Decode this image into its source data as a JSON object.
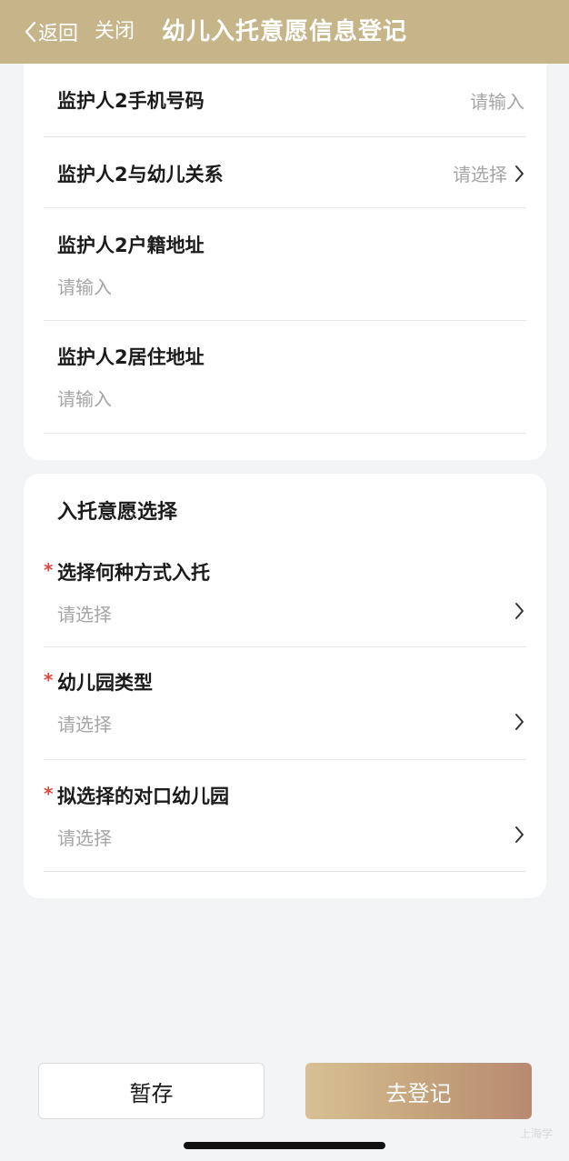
{
  "nav": {
    "back_label": "返回",
    "close_label": "关闭",
    "title": "幼儿入托意愿信息登记",
    "background": "#c7b58a"
  },
  "guardian2": {
    "phone": {
      "label": "监护人2手机号码",
      "placeholder": "请输入"
    },
    "relation": {
      "label": "监护人2与幼儿关系",
      "placeholder": "请选择"
    },
    "household_address": {
      "label": "监护人2户籍地址",
      "placeholder": "请输入"
    },
    "residence_address": {
      "label": "监护人2居住地址",
      "placeholder": "请输入"
    }
  },
  "enrollment": {
    "section_title": "入托意愿选择",
    "required_mark": "*",
    "method": {
      "label": "选择何种方式入托",
      "placeholder": "请选择"
    },
    "kindergarten_type": {
      "label": "幼儿园类型",
      "placeholder": "请选择"
    },
    "target_kindergarten": {
      "label": "拟选择的对口幼儿园",
      "placeholder": "请选择"
    }
  },
  "actions": {
    "save_draft": "暂存",
    "register": "去登记"
  },
  "watermark": "上海学",
  "colors": {
    "accent": "#c7b58a",
    "required": "#e0483e",
    "placeholder": "#a5a5a5"
  }
}
